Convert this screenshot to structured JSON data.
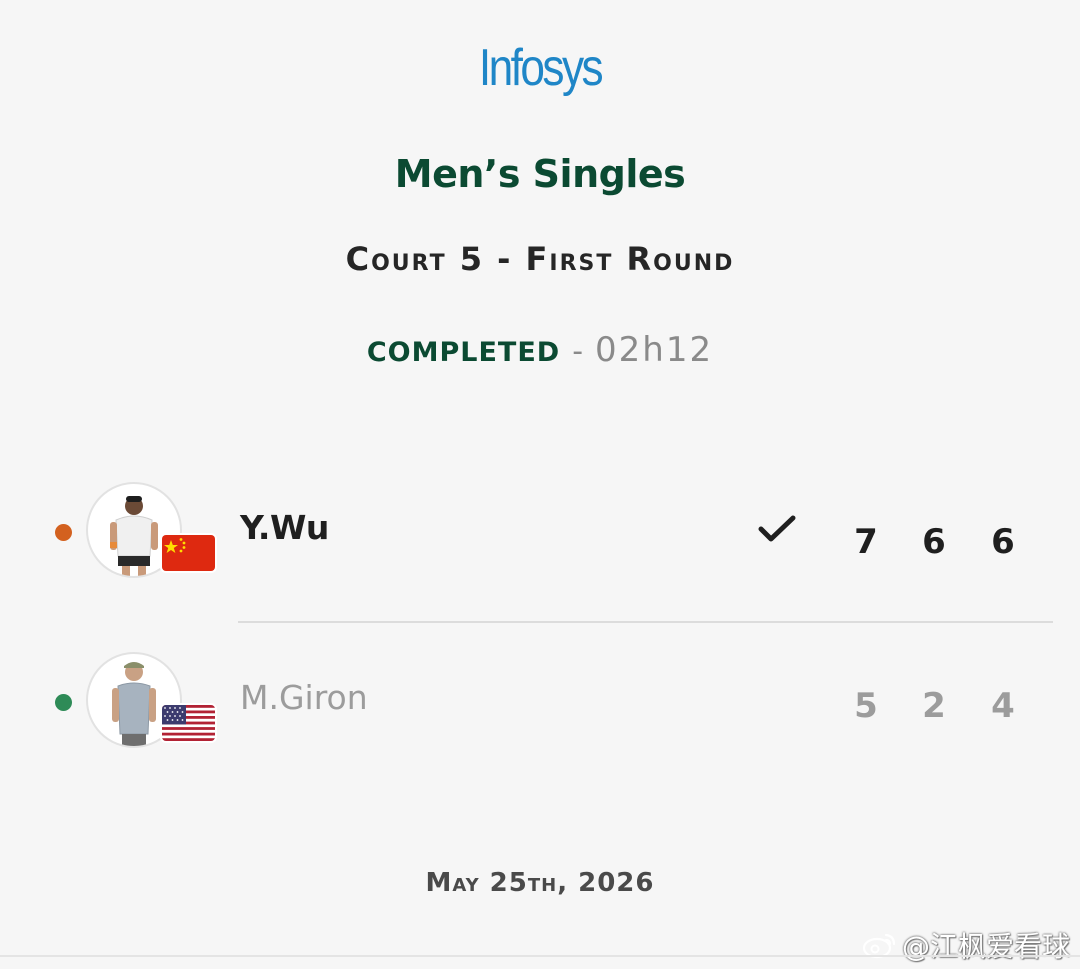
{
  "sponsor": {
    "logo_text": "Infosys",
    "color": "#1f86c7"
  },
  "match": {
    "event": "Men’s Singles",
    "court_round": "Court 5 - First Round",
    "status": "COMPLETED",
    "separator": "-",
    "duration": "02h12",
    "date": "May 25th, 2026"
  },
  "players": [
    {
      "name": "Y.Wu",
      "country_flag": "china-flag",
      "serve_dot_color": "#d3611f",
      "winner": true,
      "winner_icon": "checkmark-icon",
      "sets": [
        "7",
        "6",
        "6"
      ]
    },
    {
      "name": "M.Giron",
      "country_flag": "usa-flag",
      "serve_dot_color": "#2e8b57",
      "winner": false,
      "sets": [
        "5",
        "2",
        "4"
      ]
    }
  ],
  "watermark": {
    "text": "@江枫爱看球",
    "icon": "weibo-icon"
  },
  "colors": {
    "primary_green": "#0b4a32",
    "muted_gray": "#9c9c9c",
    "background": "#f6f6f6"
  }
}
